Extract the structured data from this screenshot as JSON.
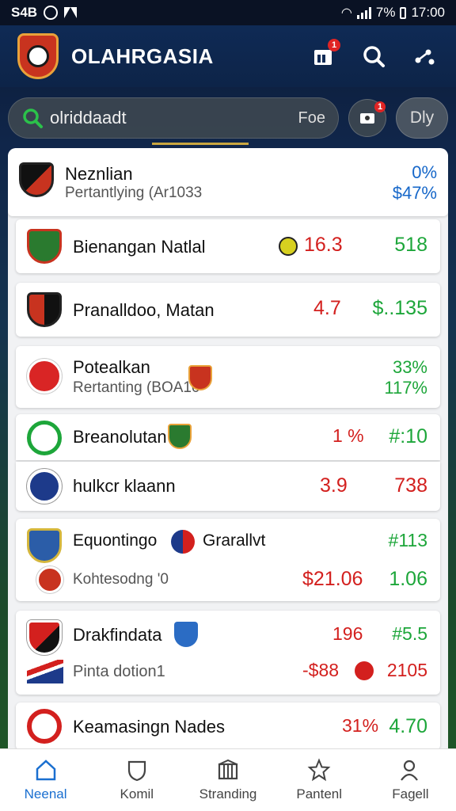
{
  "status_bar": {
    "carrier": "S4B",
    "battery_pct": "7%",
    "time": "17:00"
  },
  "header": {
    "title": "OLAHRGASIA",
    "notifications_badge": "1"
  },
  "search": {
    "query": "olriddaadt",
    "suffix": "Foe",
    "action_badge": "1",
    "filter_label": "Dly"
  },
  "rows": [
    {
      "name": "Neznlian",
      "sub": "Pertantlying (Ar1033",
      "v1": "0%",
      "v2": "$47%"
    },
    {
      "name": "Bienangan Natlal",
      "v1": "16.3",
      "v2": "518"
    },
    {
      "name": "Pranalldoo, Matan",
      "v1": "4.7",
      "v2": "$..135"
    },
    {
      "name": "Potealkan",
      "sub": "Rertanting (BOA10",
      "v1": "33%",
      "v2": "117%"
    },
    {
      "name": "Breanolutan",
      "v1": "1 %",
      "v2": "#:10"
    },
    {
      "name": "hulkcr klaann",
      "v1": "3.9",
      "v2": "738"
    },
    {
      "name": "Equontingo",
      "name2": "Grarallvt",
      "sub": "Kohtesodng '0",
      "v1": "$21.06",
      "v2": "#113",
      "v3": "1.06"
    },
    {
      "name": "Drakfindata",
      "sub": "Pinta dotion1",
      "v1": "196",
      "v2": "#5.5",
      "v3": "-$88",
      "v4": "2105"
    },
    {
      "name": "Keamasingn Nades",
      "v1": "31%",
      "v2": "4.70"
    }
  ],
  "nav": [
    {
      "label": "Neenal",
      "icon": "home-icon"
    },
    {
      "label": "Komil",
      "icon": "shield-icon"
    },
    {
      "label": "Stranding",
      "icon": "stadium-icon"
    },
    {
      "label": "Pantenl",
      "icon": "star-icon"
    },
    {
      "label": "Fagell",
      "icon": "profile-icon"
    }
  ]
}
